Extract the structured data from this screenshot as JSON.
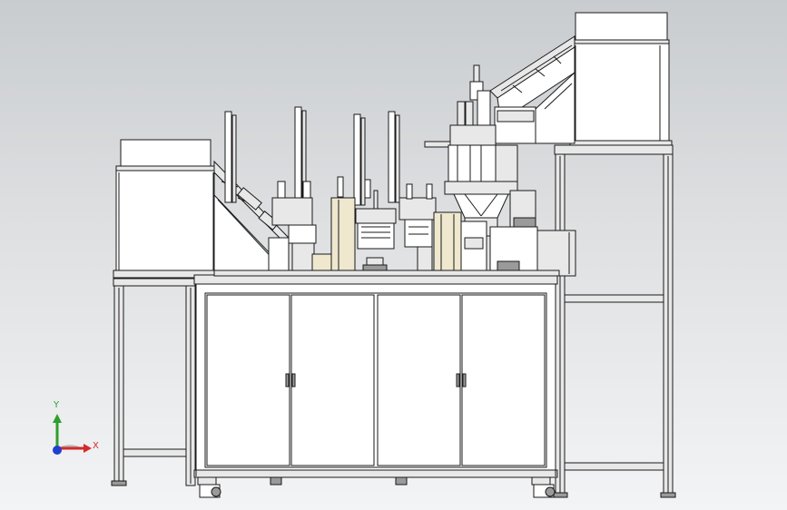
{
  "viewport": {
    "background_top": "#c9cccf",
    "background_bottom": "#f3f4f5",
    "line_color": "#1a1a1a",
    "panel_fill": "#ffffff",
    "part_fill": "#e8e8e8",
    "highlight_fill": "#efe8cf",
    "dark_fill": "#9a9a9a"
  },
  "triad": {
    "y_label": "Y",
    "x_label": "X",
    "y_color": "#2e9e2e",
    "x_color": "#d42a2a",
    "z_color": "#1f3fd0"
  }
}
